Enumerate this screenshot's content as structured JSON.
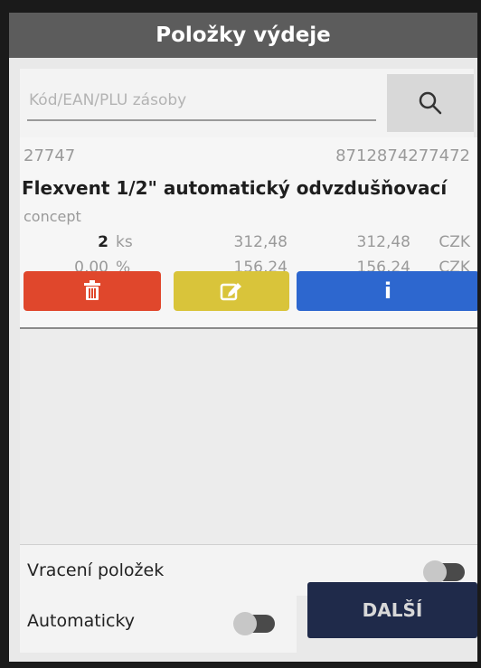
{
  "header": {
    "title": "Položky výdeje"
  },
  "search": {
    "placeholder": "Kód/EAN/PLU zásoby",
    "value": ""
  },
  "item": {
    "code": "27747",
    "ean": "8712874277472",
    "name": "Flexvent 1/2\" automatický odvzdušňovací",
    "description": "concept",
    "quantity": "2",
    "unit": "ks",
    "unit_price": "312,48",
    "total_price": "312,48",
    "currency": "CZK",
    "discount": "0,00",
    "discount_unit": "%",
    "unit_price_net": "156,24",
    "total_net": "156,24",
    "currency2": "CZK"
  },
  "actions": {
    "info_label": "i"
  },
  "returns": {
    "label": "Vracení položek",
    "enabled": false
  },
  "automatic": {
    "label": "Automaticky",
    "enabled": false
  },
  "footer": {
    "next_label": "DALŠÍ"
  },
  "colors": {
    "delete": "#e0472c",
    "edit": "#d9c43a",
    "info": "#2d67cf",
    "title_bar": "#5c5c5c",
    "next": "#1f2a4a"
  },
  "icons": {
    "search": "search-icon",
    "delete": "trash-icon",
    "edit": "edit-icon",
    "info": "info-icon"
  }
}
